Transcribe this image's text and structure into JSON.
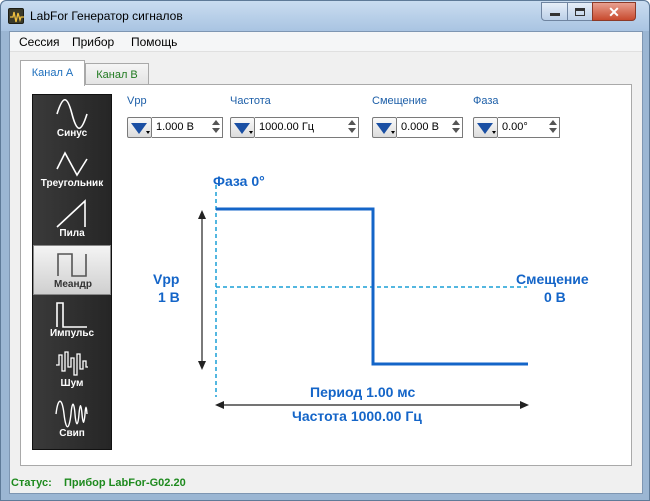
{
  "window": {
    "title": "LabFor Генератор сигналов",
    "close_glyph": "✕"
  },
  "menu": {
    "items": [
      "Сессия",
      "Прибор",
      "Помощь"
    ]
  },
  "tabs": [
    {
      "label": "Канал А",
      "active": true
    },
    {
      "label": "Канал В",
      "active": false
    }
  ],
  "waveforms": [
    {
      "label": "Синус",
      "icon": "sine-wave-icon",
      "selected": false
    },
    {
      "label": "Треугольник",
      "icon": "triangle-wave-icon",
      "selected": false
    },
    {
      "label": "Пила",
      "icon": "sawtooth-wave-icon",
      "selected": false
    },
    {
      "label": "Меандр",
      "icon": "square-wave-icon",
      "selected": true
    },
    {
      "label": "Импульс",
      "icon": "pulse-wave-icon",
      "selected": false
    },
    {
      "label": "Шум",
      "icon": "noise-wave-icon",
      "selected": false
    },
    {
      "label": "Свип",
      "icon": "sweep-wave-icon",
      "selected": false
    }
  ],
  "params": {
    "vpp": {
      "label": "Vpp",
      "value": "1.000 В"
    },
    "freq": {
      "label": "Частота",
      "value": "1000.00 Гц"
    },
    "offset": {
      "label": "Смещение",
      "value": "0.000 В"
    },
    "phase": {
      "label": "Фаза",
      "value": "0.00°"
    }
  },
  "diagram": {
    "phase_label": "Фаза 0°",
    "vpp_title": "Vpp",
    "vpp_value": "1 В",
    "offset_title": "Смещение",
    "offset_value": "0 В",
    "period_label": "Период 1.00 мс",
    "freq_label": "Частота 1000.00 Гц"
  },
  "status": {
    "label": "Статус:",
    "value": "Прибор LabFor-G02.20"
  },
  "colors": {
    "accent": "#1465c8",
    "status_green": "#1e8a1e",
    "tab_a": "#1e6fbd",
    "tab_b": "#207a20"
  }
}
